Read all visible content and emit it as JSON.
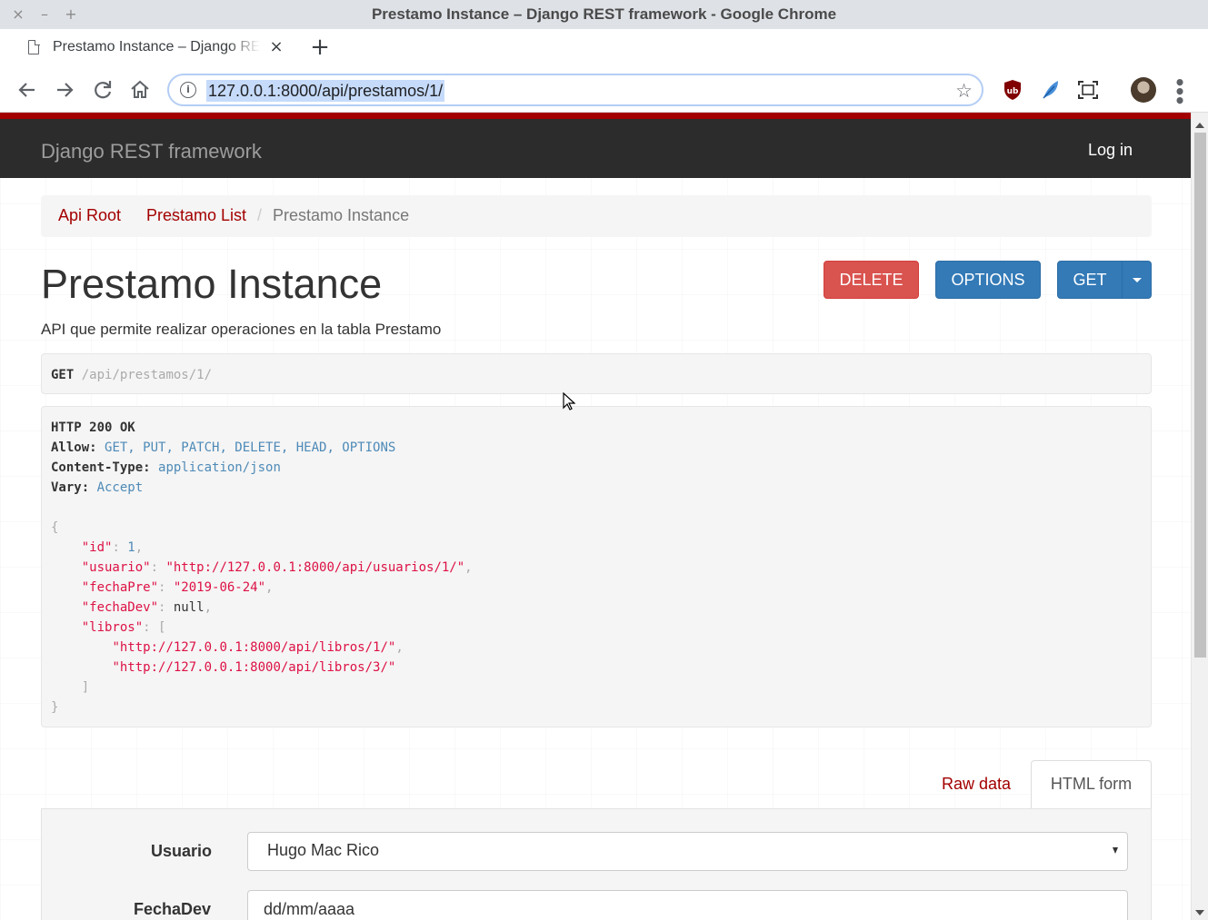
{
  "window": {
    "title": "Prestamo Instance – Django REST framework - Google Chrome",
    "close_glyph": "×",
    "minimize_glyph": "–",
    "maximize_glyph": "+"
  },
  "tab": {
    "title": "Prestamo Instance – Django REST framework",
    "close_glyph": "×",
    "new_tab_glyph": "+"
  },
  "toolbar": {
    "url": "127.0.0.1:8000/api/prestamos/1/",
    "info_glyph": "i",
    "star_glyph": "☆",
    "extensions": [
      "ublock-origin-icon",
      "feather-extension-icon",
      "screenshot-extension-icon"
    ],
    "menu_glyph": "⋮"
  },
  "navbar": {
    "brand": "Django REST framework",
    "login": "Log in",
    "accent_color": "#a30000"
  },
  "breadcrumb": [
    {
      "label": "Api Root"
    },
    {
      "label": "Prestamo List"
    },
    {
      "label": "Prestamo Instance"
    }
  ],
  "breadcrumb_sep": "/",
  "page": {
    "title": "Prestamo Instance",
    "description": "API que permite realizar operaciones en la tabla Prestamo"
  },
  "buttons": {
    "delete": "DELETE",
    "options": "OPTIONS",
    "get": "GET"
  },
  "request": {
    "method": "GET",
    "path": "/api/prestamos/1/"
  },
  "response": {
    "status": "HTTP 200 OK",
    "headers": [
      {
        "name": "Allow",
        "value": "GET, PUT, PATCH, DELETE, HEAD, OPTIONS"
      },
      {
        "name": "Content-Type",
        "value": "application/json"
      },
      {
        "name": "Vary",
        "value": "Accept"
      }
    ],
    "body": {
      "id": "1",
      "usuario": "\"http://127.0.0.1:8000/api/usuarios/1/\"",
      "fechaPre": "\"2019-06-24\"",
      "fechaDev": "null",
      "libros": [
        "\"http://127.0.0.1:8000/api/libros/1/\"",
        "\"http://127.0.0.1:8000/api/libros/3/\""
      ]
    }
  },
  "form_tabs": {
    "raw": "Raw data",
    "html": "HTML form"
  },
  "form": {
    "usuario_label": "Usuario",
    "usuario_value": "Hugo Mac Rico",
    "fechadev_label": "FechaDev",
    "fechadev_placeholder": "dd/mm/aaaa"
  }
}
